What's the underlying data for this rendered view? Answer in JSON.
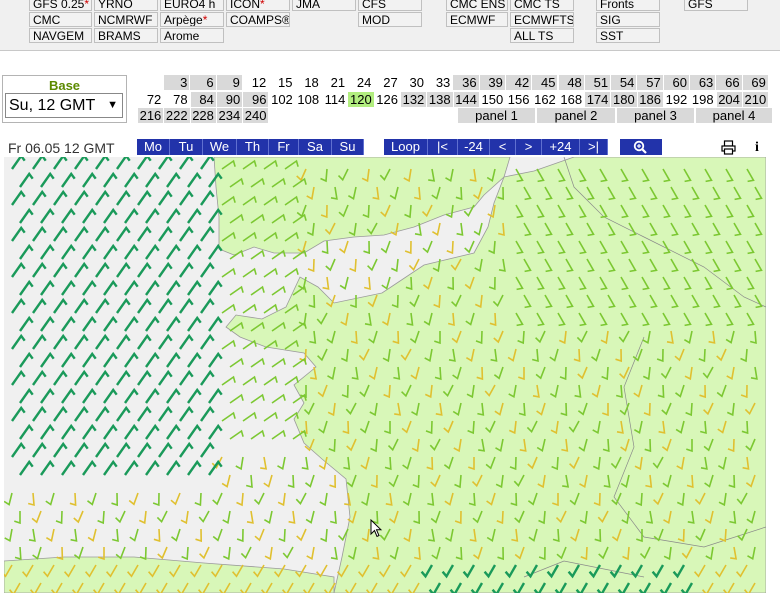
{
  "models": {
    "row0": [
      "GFS 0.25",
      "YRNO",
      "EURO4 h",
      "ICON",
      "JMA",
      "CFS",
      "CMC ENS",
      "CMC TS",
      "Fronts",
      "GFS"
    ],
    "row1": [
      "CMC",
      "NCMRWF",
      "Arpège",
      "COAMPS®",
      "MOD",
      "ECMWF",
      "ECMWFTS",
      "SIG"
    ],
    "row2": [
      "NAVGEM",
      "BRAMS",
      "Arome",
      "ALL TS",
      "SST"
    ],
    "marker": "*"
  },
  "base": {
    "label": "Base",
    "selected": "Su, 12 GMT"
  },
  "hours": {
    "row1": [
      "3",
      "6",
      "9",
      "12",
      "15",
      "18",
      "21",
      "24",
      "27",
      "30",
      "33",
      "36",
      "39",
      "42",
      "45",
      "48",
      "51",
      "54",
      "57",
      "60",
      "63",
      "66",
      "69"
    ],
    "row2": [
      "72",
      "78",
      "84",
      "90",
      "96",
      "102",
      "108",
      "114",
      "120",
      "126",
      "132",
      "138",
      "144",
      "150",
      "156",
      "162",
      "168",
      "174",
      "180",
      "186",
      "192",
      "198",
      "204",
      "210"
    ],
    "row3": [
      "216",
      "222",
      "228",
      "234",
      "240"
    ],
    "selected": "120"
  },
  "panels": [
    "panel 1",
    "panel 2",
    "panel 3",
    "panel 4"
  ],
  "nav": {
    "date": "Fr 06.05 12 GMT",
    "days": [
      "Mo",
      "Tu",
      "We",
      "Th",
      "Fr",
      "Sa",
      "Su"
    ],
    "controls": [
      "Loop",
      "|<",
      "-24",
      "<",
      ">",
      "+24",
      ">|"
    ],
    "zoom_icon": "magnifier-zoom-icon",
    "print_icon": "printer-icon",
    "info_label": "i"
  },
  "map": {
    "type": "wind barb forecast map",
    "land_color": "#d8f7b8",
    "sea_color": "#f0f0f0",
    "strong_wind_color": "#1a9a5a",
    "medium_wind_color": "#7cc832",
    "light_wind_color": "#e0c030"
  }
}
